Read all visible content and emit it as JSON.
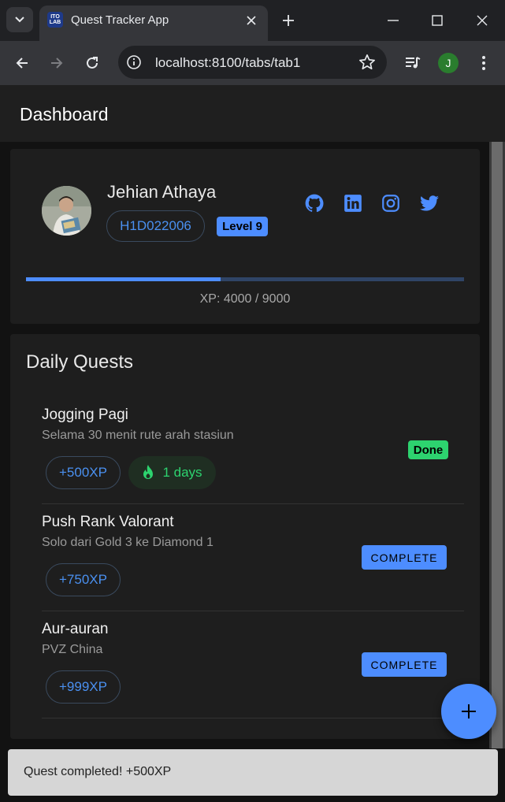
{
  "browser": {
    "tab_title": "Quest Tracker App",
    "favicon_text": "ITO LAB",
    "url": "localhost:8100/tabs/tab1",
    "profile_initial": "J"
  },
  "header": {
    "title": "Dashboard"
  },
  "profile": {
    "name": "Jehian Athaya",
    "id": "H1D022006",
    "level": "Level 9",
    "social": [
      "github-icon",
      "linkedin-icon",
      "instagram-icon",
      "twitter-icon"
    ],
    "xp_text": "XP: 4000 / 9000",
    "xp_progress": 0.444
  },
  "daily_quests": {
    "title": "Daily Quests",
    "quests": [
      {
        "title": "Jogging Pagi",
        "desc": "Selama 30 menit rute arah stasiun",
        "xp": "+500XP",
        "streak": "1 days",
        "status": "Done"
      },
      {
        "title": "Push Rank Valorant",
        "desc": "Solo dari Gold 3 ke Diamond 1",
        "xp": "+750XP",
        "action": "COMPLETE"
      },
      {
        "title": "Aur-auran",
        "desc": "PVZ China",
        "xp": "+999XP",
        "action": "COMPLETE"
      }
    ]
  },
  "toast": {
    "message": "Quest completed! +500XP"
  },
  "colors": {
    "primary": "#4d8dff",
    "success": "#2dd36f",
    "background": "#121212",
    "card": "#1e1e1e"
  }
}
